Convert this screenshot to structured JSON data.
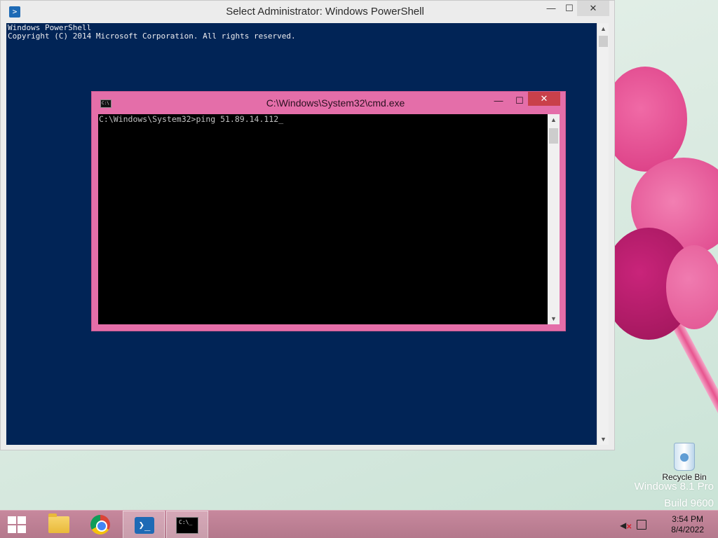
{
  "powershell": {
    "title": "Select Administrator: Windows PowerShell",
    "icon": "powershell-icon",
    "lines": [
      "Windows PowerShell",
      "Copyright (C) 2014 Microsoft Corporation. All rights reserved."
    ],
    "controls": {
      "minimize": "—",
      "maximize": "☐",
      "close": "✕"
    },
    "background": "#012456"
  },
  "cmd": {
    "title": "C:\\Windows\\System32\\cmd.exe",
    "icon": "cmd-icon",
    "icon_text": "C:\\",
    "prompt_line": "C:\\Windows\\System32>ping 51.89.14.112",
    "cursor": "_",
    "controls": {
      "minimize": "—",
      "maximize": "☐",
      "close": "✕"
    },
    "frame_color": "#e46ea9"
  },
  "desktop": {
    "recycle_bin_label": "Recycle Bin",
    "watermark_line1": "Windows 8.1 Pro",
    "watermark_line2": "Build 9600"
  },
  "taskbar": {
    "buttons": [
      {
        "name": "file-explorer",
        "icon": "folder-icon"
      },
      {
        "name": "chrome",
        "icon": "chrome-icon"
      },
      {
        "name": "powershell",
        "icon": "powershell-icon"
      },
      {
        "name": "command-prompt",
        "icon": "cmd-icon",
        "active": true
      }
    ],
    "cmd_icon_text": "C:\\_",
    "ps_icon_text": "❯_",
    "clock_time": "3:54 PM",
    "clock_date": "8/4/2022"
  }
}
